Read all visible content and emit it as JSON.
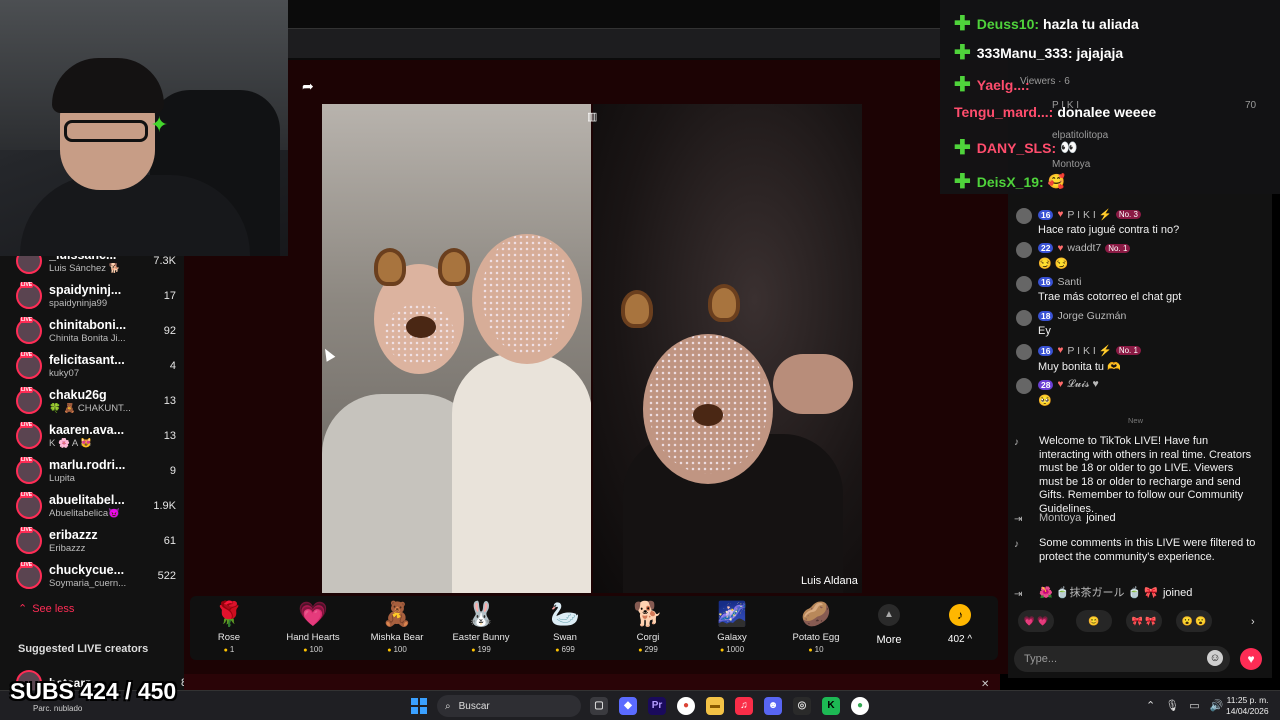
{
  "sidebar": {
    "items": [
      {
        "name": "_luissanc...",
        "sub": "Luis Sánchez 🐕",
        "count": "7.3K"
      },
      {
        "name": "spaidyninj...",
        "sub": "spaidyninja99",
        "count": "17"
      },
      {
        "name": "chinitaboni...",
        "sub": "Chinita Bonita Ji...",
        "count": "92"
      },
      {
        "name": "felicitasant...",
        "sub": "kuky07",
        "count": "4"
      },
      {
        "name": "chaku26g",
        "sub": "🍀 🧸 CHAKUNT...",
        "count": "13"
      },
      {
        "name": "kaaren.ava...",
        "sub": "K 🌸 A 😻",
        "count": "13"
      },
      {
        "name": "marlu.rodri...",
        "sub": "Lupita",
        "count": "9"
      },
      {
        "name": "abuelitabel...",
        "sub": "Abuelitabelica😈",
        "count": "1.9K"
      },
      {
        "name": "eribazzz",
        "sub": "Eribazzz",
        "count": "61"
      },
      {
        "name": "chuckycue...",
        "sub": "Soymaria_cuern...",
        "count": "522"
      }
    ],
    "live_badge": "LIVE",
    "see_less": "See less",
    "suggested_title": "Suggested LIVE creators",
    "suggested": {
      "name": "betsarz",
      "count": "8"
    }
  },
  "overlay": {
    "subs": "SUBS 424 / 450",
    "weather": "Parc. nublado",
    "chat": [
      {
        "user": "Deuss10:",
        "msg": "hazla tu aliada"
      },
      {
        "user": "333Manu_333:",
        "msg": "jajajaja"
      },
      {
        "user": "Yaelg...:",
        "msg": ""
      },
      {
        "user": "Tengu_mard...:",
        "msg": "donalee weeee"
      },
      {
        "user": "DANY_SLS:",
        "msg": "👀"
      },
      {
        "user": "DeisX_19:",
        "msg": "🥰"
      }
    ],
    "ghost_viewers": "Viewers · 6",
    "ghost_1": "P I K I",
    "ghost_2": "elpatitolitopa",
    "ghost_3": "Montoya",
    "ghost_count": "70"
  },
  "stream": {
    "host_name": "Luis Aldana"
  },
  "gifts": [
    {
      "name": "Rose",
      "price": "1",
      "icon": "🌹"
    },
    {
      "name": "Hand Hearts",
      "price": "100",
      "icon": "💗"
    },
    {
      "name": "Mishka Bear",
      "price": "100",
      "icon": "🧸"
    },
    {
      "name": "Easter Bunny",
      "price": "199",
      "icon": "🐰"
    },
    {
      "name": "Swan",
      "price": "699",
      "icon": "🦢"
    },
    {
      "name": "Corgi",
      "price": "299",
      "icon": "🐕"
    },
    {
      "name": "Galaxy",
      "price": "1000",
      "icon": "🌌"
    },
    {
      "name": "Potato Egg",
      "price": "10",
      "icon": "🥔"
    }
  ],
  "more_label": "More",
  "coins_label": "402 ^",
  "chat": {
    "messages": [
      {
        "level": "16",
        "user": "P I K I ⚡",
        "rank": "No. 3",
        "text": "Hace rato jugué contra ti no?"
      },
      {
        "level": "22",
        "user": "waddt7",
        "rank": "No. 1",
        "text": "😏 😏"
      },
      {
        "level": "16",
        "user": "Santi",
        "rank": "",
        "text": "Trae más cotorreo el chat gpt"
      },
      {
        "level": "18",
        "user": "Jorge Guzmán",
        "rank": "",
        "text": "Ey"
      },
      {
        "level": "16",
        "user": "P I K I ⚡",
        "rank": "No. 1",
        "text": "Muy bonita tu 🫶"
      },
      {
        "level": "28",
        "user": "𝓛𝓾𝓲𝓼 ♥",
        "rank": "",
        "text": "🥺"
      }
    ],
    "new_label": "New",
    "system_welcome": "Welcome to TikTok LIVE! Have fun interacting with others in real time. Creators must be 18 or older to go LIVE. Viewers must be 18 or older to recharge and send Gifts. Remember to follow our Community Guidelines.",
    "joined_user": "Montoya",
    "joined_text": "joined",
    "filtered_notice": "Some comments in this LIVE were filtered to protect the community's experience.",
    "joined2_user": "🌺 🍵抹茶ガール 🍵 🎀",
    "joined2_text": "joined",
    "quick_emojis": [
      "💗 💗",
      "😊",
      "🎀 🎀",
      "😮 😮"
    ],
    "input_placeholder": "Type..."
  },
  "taskbar": {
    "search_label": "Buscar",
    "time": "11:25 p. m.",
    "date": "14/04/2026"
  },
  "colors": {
    "accent": "#fe2c55",
    "overlay_user": "#4fd33b",
    "level_badge": "#3952d4"
  }
}
